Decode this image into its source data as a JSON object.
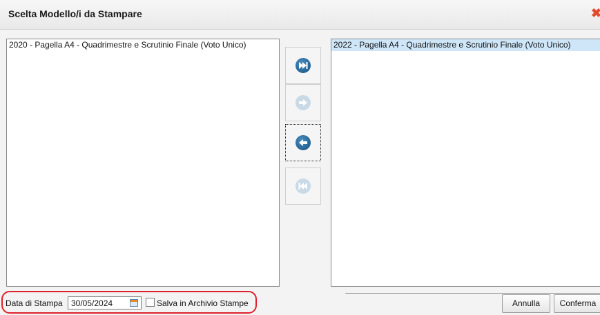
{
  "dialog": {
    "title": "Scelta Modello/i da Stampare",
    "close_icon": "close-x-icon",
    "accent_color": "#14507e",
    "highlight_color": "#e0202a"
  },
  "available_list": {
    "items": [
      {
        "label": "2020 - Pagella A4 - Quadrimestre e Scrutinio Finale (Voto Unico)",
        "selected": false
      }
    ]
  },
  "selected_list": {
    "items": [
      {
        "label": "2022 - Pagella A4 - Quadrimestre e Scrutinio Finale (Voto Unico)",
        "selected": true
      }
    ]
  },
  "transfer_buttons": [
    {
      "icon": "move-all-right-icon",
      "enabled": true
    },
    {
      "icon": "move-right-icon",
      "enabled": false
    },
    {
      "icon": "move-left-icon",
      "enabled": true
    },
    {
      "icon": "move-all-left-icon",
      "enabled": false
    }
  ],
  "footer": {
    "date_label": "Data di Stampa",
    "date_value": "30/05/2024",
    "calendar_icon": "calendar-icon",
    "archive_checkbox_label": "Salva in Archivio Stampe",
    "archive_checked": false,
    "cancel_label": "Annulla",
    "confirm_label": "Conferma"
  }
}
